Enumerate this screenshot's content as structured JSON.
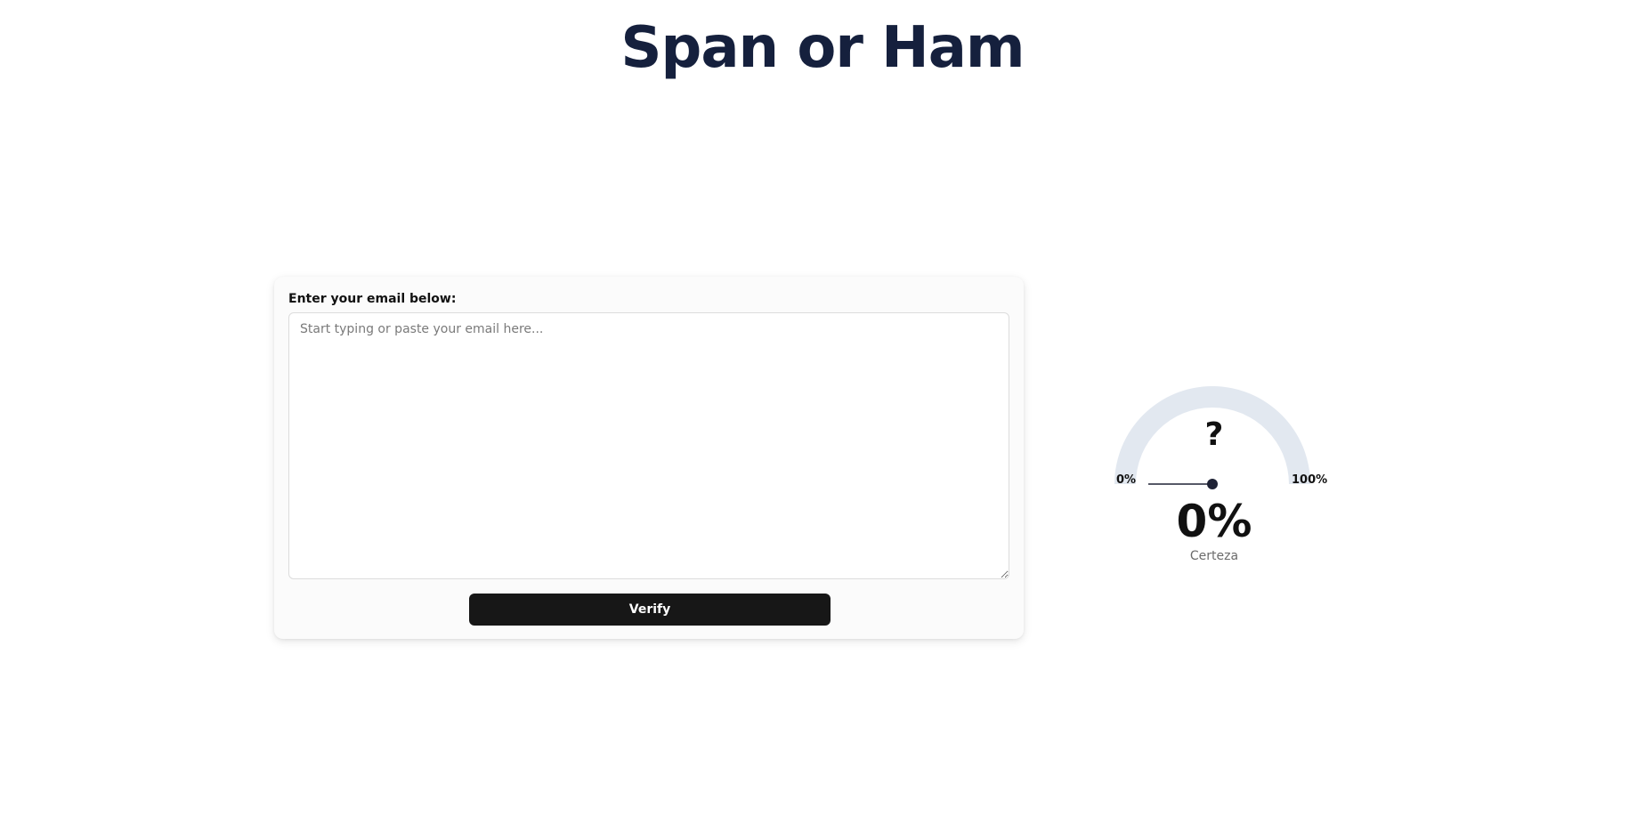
{
  "header": {
    "title": "Span or Ham"
  },
  "form": {
    "label": "Enter your email below:",
    "placeholder": "Start typing or paste your email here...",
    "value": "",
    "submit_label": "Verify"
  },
  "gauge": {
    "symbol": "?",
    "min_label": "0%",
    "max_label": "100%",
    "value": 0,
    "value_text": "0%",
    "caption": "Certeza"
  },
  "colors": {
    "title": "#15203d",
    "button": "#171717",
    "gauge_track": "#e2e8f0",
    "needle": "#1e2235"
  }
}
